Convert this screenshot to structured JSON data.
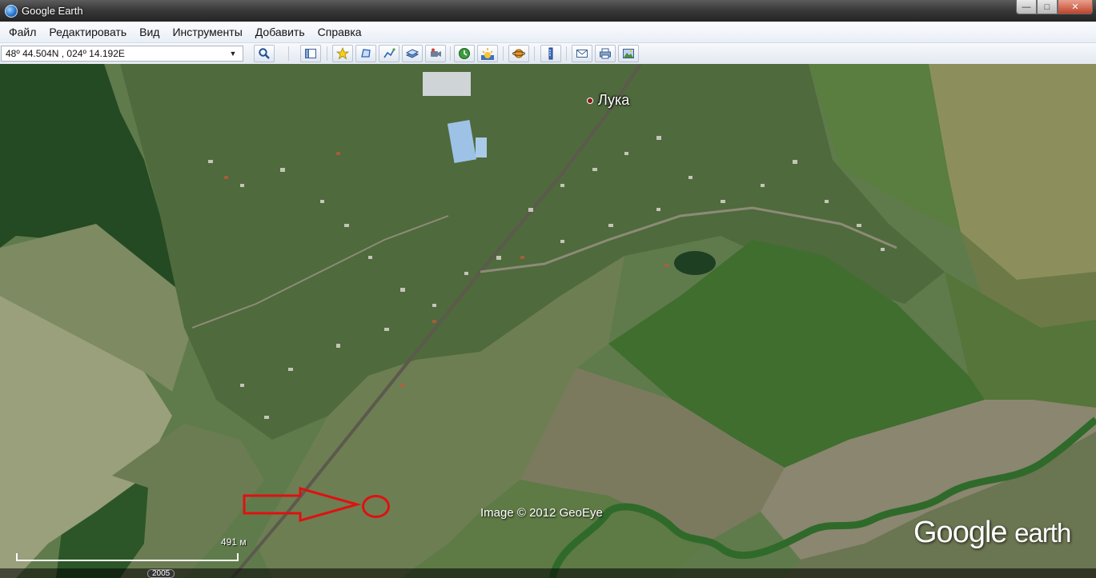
{
  "window": {
    "title": "Google Earth",
    "controls": {
      "minimize": "—",
      "maximize": "□",
      "close": "✕"
    }
  },
  "menu": {
    "items": [
      "Файл",
      "Редактировать",
      "Вид",
      "Инструменты",
      "Добавить",
      "Справка"
    ]
  },
  "toolbar": {
    "search_value": "48º 44.504N , 024º 14.192E",
    "icons": [
      "search-icon",
      "sidebar-icon",
      "placemark-icon",
      "polygon-icon",
      "path-icon",
      "image-overlay-icon",
      "record-tour-icon",
      "historical-imagery-icon",
      "sunlight-icon",
      "planets-icon",
      "ruler-icon",
      "email-icon",
      "print-icon",
      "save-image-icon"
    ]
  },
  "map": {
    "place_label": "Лука",
    "copyright": "Image © 2012 GeoEye",
    "brand_google": "Google",
    "brand_earth": "earth",
    "scale_label": "491 м",
    "imagery_year": "2005",
    "annotation_color": "#e01010"
  }
}
